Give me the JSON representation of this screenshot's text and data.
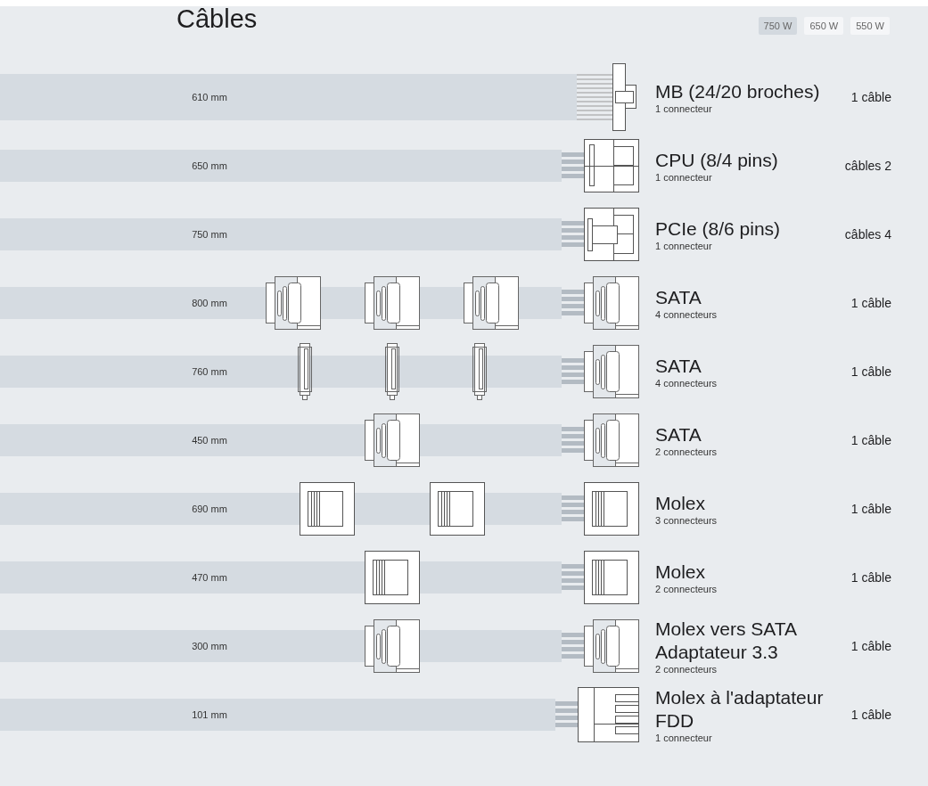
{
  "title": "Câbles",
  "wattages": [
    {
      "label": "750 W",
      "selected": true
    },
    {
      "label": "650 W",
      "selected": false
    },
    {
      "label": "550 W",
      "selected": false
    }
  ],
  "cables": [
    {
      "length": "610 mm",
      "kind": "mb",
      "name": "MB (24/20 broches)",
      "connectors": "1 connecteur",
      "count": "1 câble"
    },
    {
      "length": "650 mm",
      "kind": "cpu",
      "name": "CPU (8/4 pins)",
      "connectors": "1 connecteur",
      "count": "câbles 2"
    },
    {
      "length": "750 mm",
      "kind": "pcie",
      "name": "PCIe (8/6 pins)",
      "connectors": "1 connecteur",
      "count": "câbles 4"
    },
    {
      "length": "800 mm",
      "kind": "sata",
      "inline": [
        {
          "kind": "sata"
        },
        {
          "kind": "sata"
        },
        {
          "kind": "sata"
        }
      ],
      "name": "SATA",
      "connectors": "4 connecteurs",
      "count": "1 câble"
    },
    {
      "length": "760 mm",
      "kind": "sata",
      "inline": [
        {
          "kind": "slim"
        },
        {
          "kind": "slim"
        },
        {
          "kind": "slim"
        }
      ],
      "name": "SATA",
      "connectors": "4 connecteurs",
      "count": "1 câble"
    },
    {
      "length": "450 mm",
      "kind": "sata",
      "inline": [
        {
          "kind": "sata"
        }
      ],
      "name": "SATA",
      "connectors": "2 connecteurs",
      "count": "1 câble"
    },
    {
      "length": "690 mm",
      "kind": "molex",
      "inline": [
        {
          "kind": "molex"
        },
        {
          "kind": "molex"
        }
      ],
      "name": "Molex",
      "connectors": "3 connecteurs",
      "count": "1 câble"
    },
    {
      "length": "470 mm",
      "kind": "molex",
      "inline": [
        {
          "kind": "molex"
        }
      ],
      "name": "Molex",
      "connectors": "2 connecteurs",
      "count": "1 câble"
    },
    {
      "length": "300 mm",
      "kind": "sata",
      "inline": [
        {
          "kind": "sata"
        }
      ],
      "name": "Molex vers SATA Adaptateur 3.3",
      "connectors": "2 connecteurs",
      "count": "1 câble"
    },
    {
      "length": "101 mm",
      "kind": "fdd",
      "name": "Molex à l'adaptateur FDD",
      "connectors": "1 connecteur",
      "count": "1 câble"
    }
  ]
}
